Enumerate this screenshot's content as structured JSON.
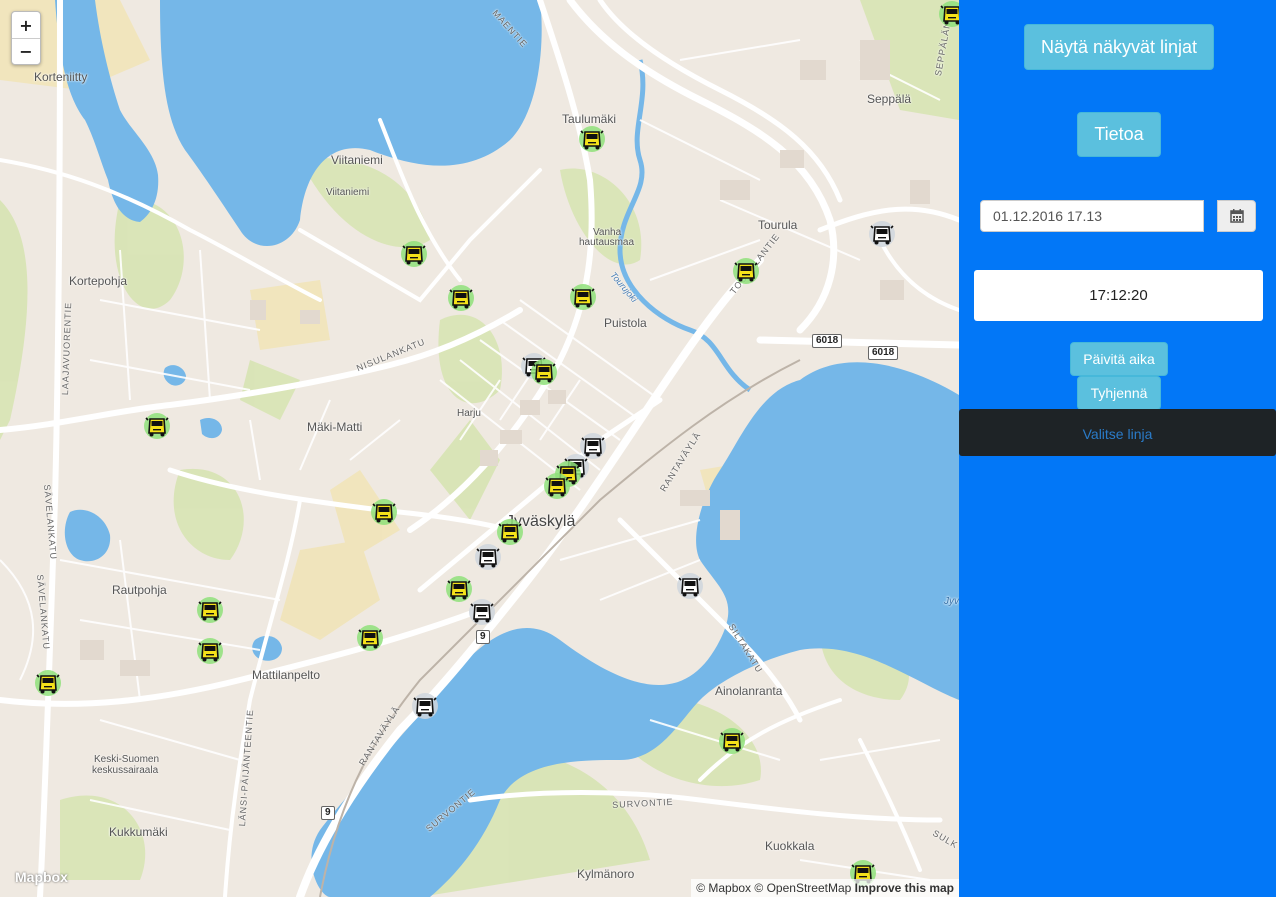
{
  "map": {
    "zoom_in": "+",
    "zoom_out": "−",
    "places": {
      "korteniitty": "Korteniitty",
      "viitaniemi": "Viitaniemi",
      "viitaniemi2": "Viitaniemi",
      "taulumaki": "Taulumäki",
      "seppala": "Seppälä",
      "kortepohja": "Kortepohja",
      "vanha": "Vanha",
      "hautausmaa": "hautausmaa",
      "tourula": "Tourula",
      "puistola": "Puistola",
      "harju": "Harju",
      "makimatti": "Mäki-Matti",
      "jyvaskyla": "Jyväskylä",
      "rautpohja": "Rautpohja",
      "mattilanpelto": "Mattilanpelto",
      "ainolanranta": "Ainolanranta",
      "keskisuomen": "Keski-Suomen",
      "keskussairaala": "keskussairaala",
      "kukkumaki": "Kukkumäki",
      "kuokkala": "Kuokkala",
      "kylmanoro": "Kylmänoro",
      "jyv": "Jyv"
    },
    "streets": {
      "maentie": "MAENTIE",
      "seppalantie": "SEPPÄLÄNTIE",
      "nisulankatu": "NISULANKATU",
      "laajavuorentie": "LAAJAVUORENTIE",
      "savelankatu1": "SÄVELANKATU",
      "savelankatu2": "SÄVELANKATU",
      "rantavayla1": "RANTAVÄYLÄ",
      "rantavayla2": "RANTAVÄYLÄ",
      "siltakatu": "SILTAKATU",
      "survontie1": "SURVONTIE",
      "survontie2": "SURVONTIE",
      "lansipaijanteentie": "LÄNSI-PÄIJÄNTEENTIE",
      "tourujoki": "Tourujoki",
      "tourulantie": "TOURULANTIE",
      "sulk": "SULK"
    },
    "shields": {
      "r6018a": "6018",
      "r6018b": "6018",
      "r9a": "9",
      "r9b": "9"
    },
    "logo": "Mapbox",
    "attribution": {
      "mapbox": "© Mapbox",
      "osm": "© OpenStreetMap",
      "improve": "Improve this map"
    }
  },
  "buses": [
    {
      "kind": "yellow"
    },
    {
      "kind": "yellow"
    },
    {
      "kind": "yellow"
    },
    {
      "kind": "yellow"
    },
    {
      "kind": "yellow"
    },
    {
      "kind": "yellow"
    },
    {
      "kind": "white"
    },
    {
      "kind": "white"
    },
    {
      "kind": "yellow"
    },
    {
      "kind": "yellow"
    },
    {
      "kind": "white"
    },
    {
      "kind": "white"
    },
    {
      "kind": "yellow"
    },
    {
      "kind": "yellow"
    },
    {
      "kind": "yellow"
    },
    {
      "kind": "yellow"
    },
    {
      "kind": "white"
    },
    {
      "kind": "yellow"
    },
    {
      "kind": "white"
    },
    {
      "kind": "yellow"
    },
    {
      "kind": "yellow"
    },
    {
      "kind": "yellow"
    },
    {
      "kind": "yellow"
    },
    {
      "kind": "white"
    },
    {
      "kind": "yellow"
    },
    {
      "kind": "white"
    },
    {
      "kind": "yellow"
    }
  ],
  "panel": {
    "show_lines_button": "Näytä näkyvät linjat",
    "info_button": "Tietoa",
    "datetime_value": "01.12.2016 17.13",
    "calendar_icon": "calendar-icon",
    "clock": "17:12:20",
    "update_button": "Päivitä aika",
    "clear_button": "Tyhjennä",
    "line_select": "Valitse linja"
  },
  "colors": {
    "panel_bg": "#0277f7",
    "info_button": "#5bc0de",
    "water": "#75b7e8",
    "park": "#cfe2a6",
    "select_bg": "#1e2326"
  }
}
